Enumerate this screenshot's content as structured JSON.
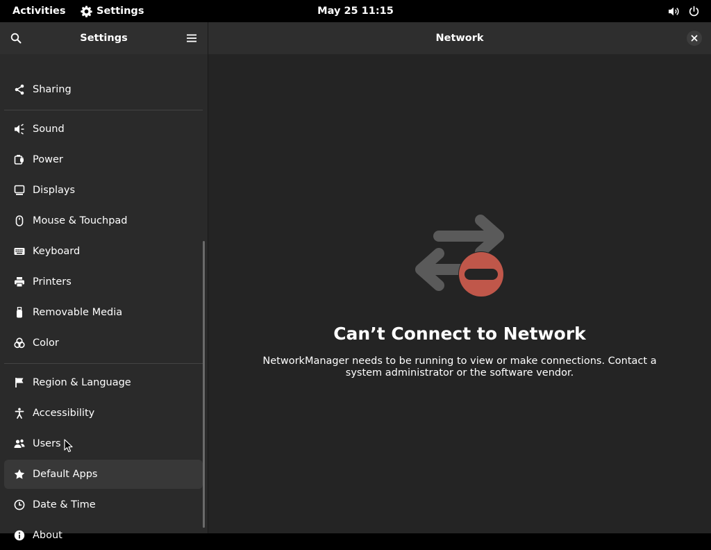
{
  "topbar": {
    "activities": "Activities",
    "app_name": "Settings",
    "app_icon": "gear-icon",
    "clock": "May 25  11:15",
    "status_icons": [
      "volume-icon",
      "power-icon"
    ]
  },
  "sidebar": {
    "title": "Settings",
    "search_icon": "search-icon",
    "menu_icon": "hamburger-menu-icon",
    "items": [
      {
        "label": "Sharing",
        "icon": "share-icon"
      },
      {
        "label": "Sound",
        "icon": "speaker-icon"
      },
      {
        "label": "Power",
        "icon": "battery-plug-icon"
      },
      {
        "label": "Displays",
        "icon": "monitor-icon"
      },
      {
        "label": "Mouse & Touchpad",
        "icon": "mouse-icon"
      },
      {
        "label": "Keyboard",
        "icon": "keyboard-icon"
      },
      {
        "label": "Printers",
        "icon": "printer-icon"
      },
      {
        "label": "Removable Media",
        "icon": "usb-drive-icon"
      },
      {
        "label": "Color",
        "icon": "color-circles-icon"
      },
      {
        "label": "Region & Language",
        "icon": "flag-icon"
      },
      {
        "label": "Accessibility",
        "icon": "accessibility-person-icon"
      },
      {
        "label": "Users",
        "icon": "users-icon"
      },
      {
        "label": "Default Apps",
        "icon": "star-icon",
        "selected": true
      },
      {
        "label": "Date & Time",
        "icon": "clock-icon"
      },
      {
        "label": "About",
        "icon": "info-icon"
      }
    ]
  },
  "content": {
    "title": "Network",
    "close_icon": "close-icon",
    "status": {
      "icon": "network-disabled-icon",
      "title": "Can’t Connect to Network",
      "description": "NetworkManager needs to be running to view or make connections. Contact a system administrator or the software vendor."
    }
  },
  "colors": {
    "topbar_bg": "#000000",
    "sidebar_bg": "#2a2a2a",
    "content_bg": "#242424",
    "selected_row": "#383838",
    "status_icon_gray": "#5a5a5a",
    "status_icon_red": "#c0574a"
  }
}
